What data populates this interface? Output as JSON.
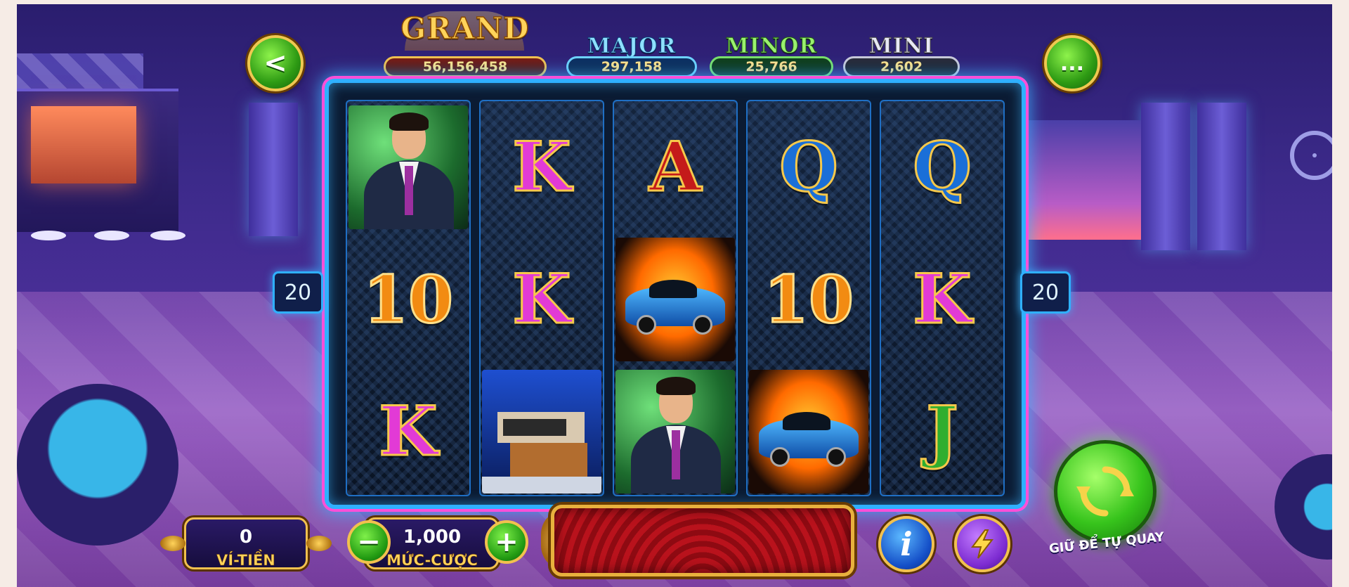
{
  "jackpots": {
    "grand": {
      "label": "GRAND",
      "value": "56,156,458"
    },
    "major": {
      "label": "MAJOR",
      "value": "297,158"
    },
    "minor": {
      "label": "MINOR",
      "value": "25,766"
    },
    "mini": {
      "label": "MINI",
      "value": "2,602"
    }
  },
  "nav": {
    "back_icon": "<",
    "menu_icon": "..."
  },
  "reels": [
    {
      "symbols": [
        "man",
        "10",
        "K"
      ]
    },
    {
      "symbols": [
        "K",
        "K",
        "house"
      ]
    },
    {
      "symbols": [
        "A",
        "car",
        "man"
      ]
    },
    {
      "symbols": [
        "Q",
        "10",
        "car"
      ]
    },
    {
      "symbols": [
        "Q",
        "K",
        "J"
      ]
    }
  ],
  "paylines": {
    "left": "20",
    "right": "20"
  },
  "wallet": {
    "value": "0",
    "label": "VÍ-TIỀN"
  },
  "bet": {
    "value": "1,000",
    "label": "MỨC-CƯỢC",
    "minus": "−",
    "plus": "+"
  },
  "controls": {
    "info_icon": "i",
    "turbo_icon": "lightning-icon",
    "spin_icon": "refresh-icon",
    "spin_hold_label": "GIỮ ĐỂ TỰ QUAY"
  },
  "colors": {
    "frame": "#2fb0ff",
    "frame_glow": "#ff4fd8",
    "gold": "#f2c14e"
  }
}
